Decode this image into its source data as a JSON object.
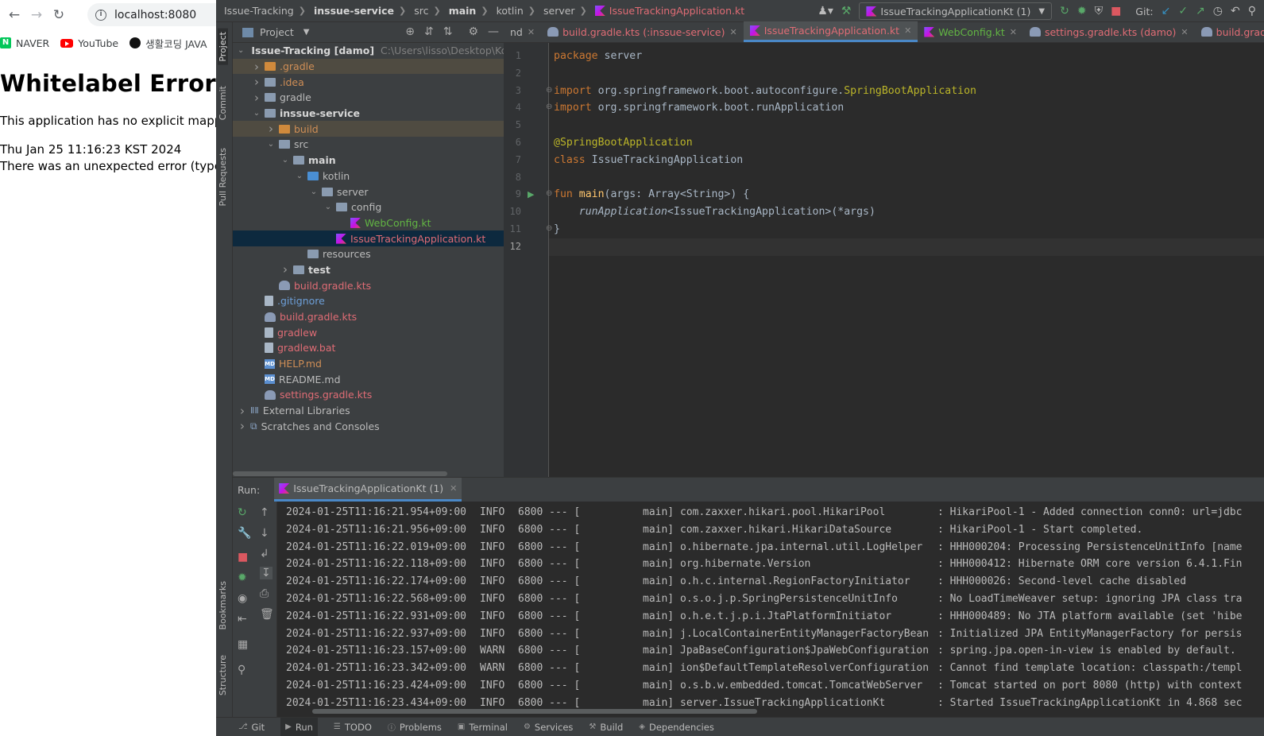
{
  "browser": {
    "url": "localhost:8080",
    "bookmarks": [
      {
        "label": "NAVER",
        "icon": "naver-icon"
      },
      {
        "label": "YouTube",
        "icon": "youtube-icon"
      },
      {
        "label": "생활코딩 JAVA",
        "icon": "dot-icon"
      }
    ],
    "page": {
      "heading": "Whitelabel Error P",
      "line1": "This application has no explicit mappi",
      "line2": "Thu Jan 25 11:16:23 KST 2024",
      "line3": "There was an unexpected error (type="
    }
  },
  "ide": {
    "breadcrumbs": [
      "Issue-Tracking",
      "inssue-service",
      "src",
      "main",
      "kotlin",
      "server",
      "IssueTrackingApplication.kt"
    ],
    "run_config": "IssueTrackingApplicationKt (1)",
    "git_label": "Git:",
    "side_tabs": [
      "Project",
      "Commit",
      "Pull Requests",
      "Bookmarks",
      "Structure"
    ],
    "project": {
      "title": "Project",
      "tree": [
        {
          "label": "Issue-Tracking [damo]",
          "extra": "C:\\Users\\lisso\\Desktop\\Kotlin\\",
          "depth": 0,
          "arrow": "open",
          "icon": "folder",
          "style": "bold"
        },
        {
          "label": ".gradle",
          "depth": 1,
          "arrow": "closed",
          "icon": "folder-orange",
          "style": "orange",
          "hl": "yellow"
        },
        {
          "label": ".idea",
          "depth": 1,
          "arrow": "closed",
          "icon": "folder",
          "style": "orange"
        },
        {
          "label": "gradle",
          "depth": 1,
          "arrow": "closed",
          "icon": "folder",
          "style": ""
        },
        {
          "label": "inssue-service",
          "depth": 1,
          "arrow": "open",
          "icon": "folder",
          "style": "bold"
        },
        {
          "label": "build",
          "depth": 2,
          "arrow": "closed",
          "icon": "folder-orange",
          "style": "orange",
          "hl": "yellow"
        },
        {
          "label": "src",
          "depth": 2,
          "arrow": "open",
          "icon": "folder",
          "style": ""
        },
        {
          "label": "main",
          "depth": 3,
          "arrow": "open",
          "icon": "folder",
          "style": "bold"
        },
        {
          "label": "kotlin",
          "depth": 4,
          "arrow": "open",
          "icon": "folder-blue",
          "style": ""
        },
        {
          "label": "server",
          "depth": 5,
          "arrow": "open",
          "icon": "folder",
          "style": ""
        },
        {
          "label": "config",
          "depth": 6,
          "arrow": "open",
          "icon": "folder",
          "style": ""
        },
        {
          "label": "WebConfig.kt",
          "depth": 7,
          "arrow": "",
          "icon": "kt",
          "style": "green"
        },
        {
          "label": "IssueTrackingApplication.kt",
          "depth": 6,
          "arrow": "",
          "icon": "kt",
          "style": "red",
          "hl": "sel"
        },
        {
          "label": "resources",
          "depth": 4,
          "arrow": "",
          "icon": "folder",
          "style": ""
        },
        {
          "label": "test",
          "depth": 3,
          "arrow": "closed",
          "icon": "folder",
          "style": "bold"
        },
        {
          "label": "build.gradle.kts",
          "depth": 2,
          "arrow": "",
          "icon": "kts",
          "style": "red"
        },
        {
          "label": ".gitignore",
          "depth": 1,
          "arrow": "",
          "icon": "file",
          "style": "blue"
        },
        {
          "label": "build.gradle.kts",
          "depth": 1,
          "arrow": "",
          "icon": "kts",
          "style": "red"
        },
        {
          "label": "gradlew",
          "depth": 1,
          "arrow": "",
          "icon": "file",
          "style": "red"
        },
        {
          "label": "gradlew.bat",
          "depth": 1,
          "arrow": "",
          "icon": "file",
          "style": "red"
        },
        {
          "label": "HELP.md",
          "depth": 1,
          "arrow": "",
          "icon": "md",
          "style": "orange"
        },
        {
          "label": "README.md",
          "depth": 1,
          "arrow": "",
          "icon": "md",
          "style": ""
        },
        {
          "label": "settings.gradle.kts",
          "depth": 1,
          "arrow": "",
          "icon": "kts",
          "style": "red"
        },
        {
          "label": "External Libraries",
          "depth": 0,
          "arrow": "closed",
          "icon": "lib",
          "style": ""
        },
        {
          "label": "Scratches and Consoles",
          "depth": 0,
          "arrow": "closed",
          "icon": "scratch",
          "style": ""
        }
      ]
    },
    "editor": {
      "tabs": [
        {
          "label": "nd",
          "icon": "",
          "style": ""
        },
        {
          "label": "build.gradle.kts (:inssue-service)",
          "icon": "kts",
          "style": "red"
        },
        {
          "label": "IssueTrackingApplication.kt",
          "icon": "kt",
          "style": "red",
          "active": true
        },
        {
          "label": "WebConfig.kt",
          "icon": "kt",
          "style": "green"
        },
        {
          "label": "settings.gradle.kts (damo)",
          "icon": "kts",
          "style": "red"
        },
        {
          "label": "build.gradle.kts (damo)",
          "icon": "kts",
          "style": "red"
        }
      ],
      "line_numbers": [
        "1",
        "2",
        "3",
        "4",
        "5",
        "6",
        "7",
        "8",
        "9",
        "10",
        "11",
        "12"
      ],
      "code": [
        [
          {
            "t": "package",
            "c": "kw"
          },
          {
            "t": " server",
            "c": ""
          }
        ],
        [],
        [
          {
            "t": "import",
            "c": "kw"
          },
          {
            "t": " org.springframework.boot.autoconfigure.",
            "c": ""
          },
          {
            "t": "SpringBootApplication",
            "c": "cls"
          }
        ],
        [
          {
            "t": "import",
            "c": "kw"
          },
          {
            "t": " org.springframework.boot.runApplication",
            "c": ""
          }
        ],
        [],
        [
          {
            "t": "@SpringBootApplication",
            "c": "ann"
          }
        ],
        [
          {
            "t": "class",
            "c": "kw"
          },
          {
            "t": " IssueTrackingApplication",
            "c": ""
          }
        ],
        [],
        [
          {
            "t": "fun",
            "c": "kw"
          },
          {
            "t": " ",
            "c": ""
          },
          {
            "t": "main",
            "c": "fn"
          },
          {
            "t": "(args: Array<String>) {",
            "c": ""
          }
        ],
        [
          {
            "t": "    ",
            "c": ""
          },
          {
            "t": "runApplication",
            "c": "it"
          },
          {
            "t": "<IssueTrackingApplication>(*args)",
            "c": ""
          }
        ],
        [
          {
            "t": "}",
            "c": ""
          }
        ],
        []
      ]
    },
    "run": {
      "label": "Run:",
      "tab": "IssueTrackingApplicationKt (1)",
      "log": [
        {
          "ts": "2024-01-25T11:16:21.954+09:00",
          "lv": "INFO",
          "pid": "6800 --- [",
          "th": "main]",
          "lg": "com.zaxxer.hikari.pool.HikariPool",
          "ms": ": HikariPool-1 - Added connection conn0: url=jdbc"
        },
        {
          "ts": "2024-01-25T11:16:21.956+09:00",
          "lv": "INFO",
          "pid": "6800 --- [",
          "th": "main]",
          "lg": "com.zaxxer.hikari.HikariDataSource",
          "ms": ": HikariPool-1 - Start completed."
        },
        {
          "ts": "2024-01-25T11:16:22.019+09:00",
          "lv": "INFO",
          "pid": "6800 --- [",
          "th": "main]",
          "lg": "o.hibernate.jpa.internal.util.LogHelper",
          "ms": ": HHH000204: Processing PersistenceUnitInfo [name"
        },
        {
          "ts": "2024-01-25T11:16:22.118+09:00",
          "lv": "INFO",
          "pid": "6800 --- [",
          "th": "main]",
          "lg": "org.hibernate.Version",
          "ms": ": HHH000412: Hibernate ORM core version 6.4.1.Fin"
        },
        {
          "ts": "2024-01-25T11:16:22.174+09:00",
          "lv": "INFO",
          "pid": "6800 --- [",
          "th": "main]",
          "lg": "o.h.c.internal.RegionFactoryInitiator",
          "ms": ": HHH000026: Second-level cache disabled"
        },
        {
          "ts": "2024-01-25T11:16:22.568+09:00",
          "lv": "INFO",
          "pid": "6800 --- [",
          "th": "main]",
          "lg": "o.s.o.j.p.SpringPersistenceUnitInfo",
          "ms": ": No LoadTimeWeaver setup: ignoring JPA class tra"
        },
        {
          "ts": "2024-01-25T11:16:22.931+09:00",
          "lv": "INFO",
          "pid": "6800 --- [",
          "th": "main]",
          "lg": "o.h.e.t.j.p.i.JtaPlatformInitiator",
          "ms": ": HHH000489: No JTA platform available (set 'hibe"
        },
        {
          "ts": "2024-01-25T11:16:22.937+09:00",
          "lv": "INFO",
          "pid": "6800 --- [",
          "th": "main]",
          "lg": "j.LocalContainerEntityManagerFactoryBean",
          "ms": ": Initialized JPA EntityManagerFactory for persis"
        },
        {
          "ts": "2024-01-25T11:16:23.157+09:00",
          "lv": "WARN",
          "pid": "6800 --- [",
          "th": "main]",
          "lg": "JpaBaseConfiguration$JpaWebConfiguration",
          "ms": ": spring.jpa.open-in-view is enabled by default."
        },
        {
          "ts": "2024-01-25T11:16:23.342+09:00",
          "lv": "WARN",
          "pid": "6800 --- [",
          "th": "main]",
          "lg": "ion$DefaultTemplateResolverConfiguration",
          "ms": ": Cannot find template location: classpath:/templ"
        },
        {
          "ts": "2024-01-25T11:16:23.424+09:00",
          "lv": "INFO",
          "pid": "6800 --- [",
          "th": "main]",
          "lg": "o.s.b.w.embedded.tomcat.TomcatWebServer",
          "ms": ": Tomcat started on port 8080 (http) with context"
        },
        {
          "ts": "2024-01-25T11:16:23.434+09:00",
          "lv": "INFO",
          "pid": "6800 --- [",
          "th": "main]",
          "lg": "server.IssueTrackingApplicationKt",
          "ms": ": Started IssueTrackingApplicationKt in 4.868 sec"
        }
      ]
    },
    "bottom_tabs": [
      {
        "label": "Git",
        "icon": "git-icon"
      },
      {
        "label": "Run",
        "icon": "run-icon",
        "active": true
      },
      {
        "label": "TODO",
        "icon": "todo-icon"
      },
      {
        "label": "Problems",
        "icon": "problems-icon"
      },
      {
        "label": "Terminal",
        "icon": "terminal-icon"
      },
      {
        "label": "Services",
        "icon": "services-icon"
      },
      {
        "label": "Build",
        "icon": "build-icon"
      },
      {
        "label": "Dependencies",
        "icon": "dependencies-icon"
      }
    ]
  }
}
